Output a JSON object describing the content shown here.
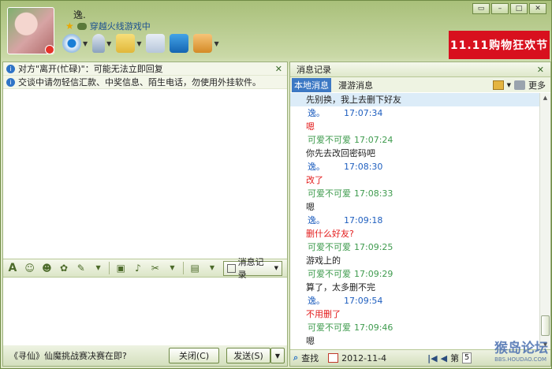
{
  "header": {
    "nickname": "逸.",
    "status": "穿越火线游戏中",
    "banner_text": "11.11购物狂欢节"
  },
  "notices": [
    {
      "text": "对方\"离开(忙碌)\"：可能无法立即回复",
      "closable": true
    },
    {
      "text": "交谈中请勿轻信汇款、中奖信息、陌生电话，勿使用外挂软件。",
      "closable": false
    }
  ],
  "format_bar": {
    "history_label": "消息记录"
  },
  "footer_left": {
    "promo": "《寻仙》仙魔挑战赛决赛在即?",
    "close_label": "关闭(C)",
    "send_label": "发送(S)"
  },
  "history_panel": {
    "title": "消息记录",
    "tabs": [
      "本地消息",
      "漫游消息"
    ],
    "more_label": "更多",
    "entries": [
      {
        "text": "先别换，我上去删下好友",
        "color": "dark",
        "kind": "text",
        "highlight": true
      },
      {
        "sender": "逸。",
        "time": "17:07:34",
        "color": "blue",
        "kind": "meta"
      },
      {
        "text": "嗯",
        "color": "red",
        "kind": "text"
      },
      {
        "sender": "可爱不可爱",
        "time": "17:07:24",
        "color": "green",
        "kind": "meta"
      },
      {
        "text": "你先去改回密码吧",
        "color": "dark",
        "kind": "text"
      },
      {
        "sender": "逸。",
        "time": "17:08:30",
        "color": "blue",
        "kind": "meta"
      },
      {
        "text": "改了",
        "color": "red",
        "kind": "text"
      },
      {
        "sender": "可爱不可爱",
        "time": "17:08:33",
        "color": "green",
        "kind": "meta"
      },
      {
        "text": "嗯",
        "color": "dark",
        "kind": "text"
      },
      {
        "sender": "逸。",
        "time": "17:09:18",
        "color": "blue",
        "kind": "meta"
      },
      {
        "text": "删什么好友?",
        "color": "red",
        "kind": "text"
      },
      {
        "sender": "可爱不可爱",
        "time": "17:09:25",
        "color": "green",
        "kind": "meta"
      },
      {
        "text": "游戏上的",
        "color": "dark",
        "kind": "text"
      },
      {
        "sender": "可爱不可爱",
        "time": "17:09:29",
        "color": "green",
        "kind": "meta"
      },
      {
        "text": "算了，太多删不完",
        "color": "dark",
        "kind": "text"
      },
      {
        "sender": "逸。",
        "time": "17:09:54",
        "color": "blue",
        "kind": "meta"
      },
      {
        "text": "不用删了",
        "color": "red",
        "kind": "text"
      },
      {
        "sender": "可爱不可爱",
        "time": "17:09:46",
        "color": "green",
        "kind": "meta"
      },
      {
        "text": "嗯",
        "color": "dark",
        "kind": "text"
      }
    ],
    "bottom": {
      "search_label": "查找",
      "date": "2012-11-4",
      "page_prefix": "第",
      "page": "5"
    }
  },
  "watermark": {
    "text": "猴岛论坛",
    "sub": "BBS.HOUDAO.COM"
  },
  "colors": {
    "accent": "#3d79c4",
    "red": "#e31b1b",
    "green": "#3f9b4e",
    "blue": "#1f5fbf"
  }
}
